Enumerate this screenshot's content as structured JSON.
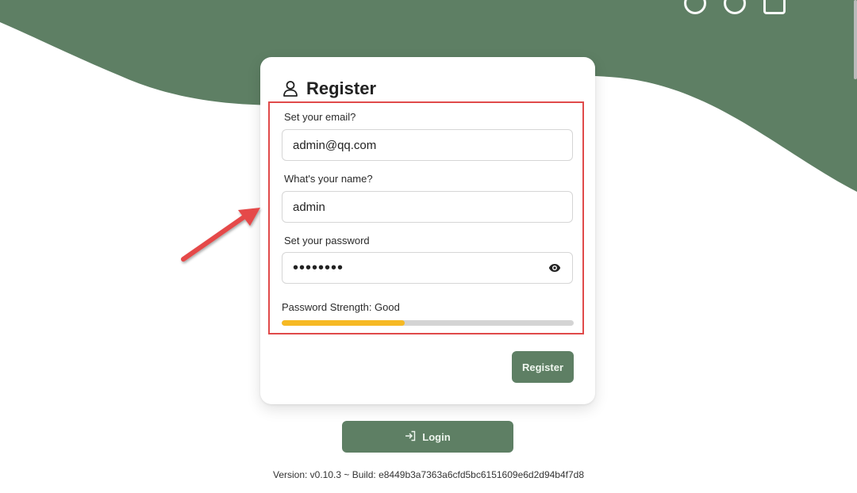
{
  "header": {
    "icons": [
      "settings-icon",
      "circle-icon",
      "search-icon"
    ]
  },
  "register": {
    "title": "Register",
    "email_label": "Set your email?",
    "email_value": "admin@qq.com",
    "name_label": "What's your name?",
    "name_value": "admin",
    "password_label": "Set your password",
    "password_masked": "••••••••",
    "strength_label": "Password Strength: Good",
    "strength_fraction": 0.42,
    "submit_label": "Register"
  },
  "login": {
    "label": "Login"
  },
  "footer": {
    "version": "Version: v0.10.3 ~ Build: e8449b3a7363a6cfd5bc6151609e6d2d94b4f7d8"
  },
  "colors": {
    "brand_green": "#5e7f64",
    "strength_good": "#f6b924",
    "highlight_red": "#e04a4a"
  }
}
